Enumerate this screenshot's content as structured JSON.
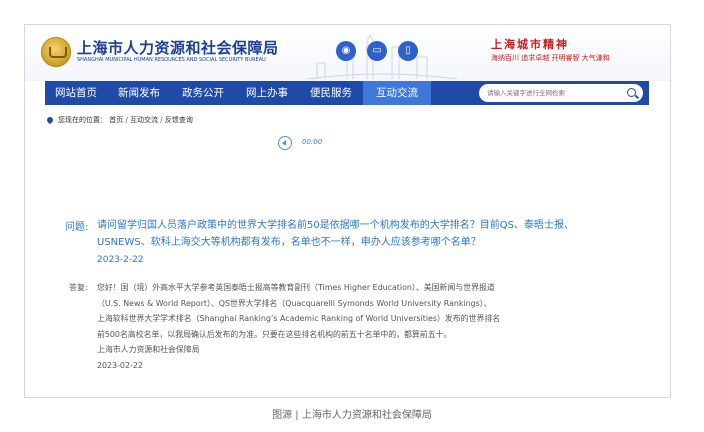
{
  "header": {
    "org_name": "上海市人力资源和社会保障局",
    "org_name_en": "SHANGHAI MUNICIPAL HUMAN RESOURCES AND SOCIAL SECURITY BUREAU",
    "social_icons": [
      "weibo-icon",
      "app-icon",
      "mobile-icon"
    ],
    "spirit_title": "上海城市精神",
    "spirit_sub": "海纳百川  追求卓越  开明睿智  大气谦和"
  },
  "nav": {
    "items": [
      "网站首页",
      "新闻发布",
      "政务公开",
      "网上办事",
      "便民服务",
      "互动交流"
    ],
    "active_index": 5,
    "search_placeholder": "请输入关键字进行全网检索"
  },
  "breadcrumb": {
    "label": "您现在的位置：",
    "items": [
      "首页",
      "互动交流",
      "反馈查询"
    ]
  },
  "audio": {
    "time": "00:00"
  },
  "question": {
    "label": "问题:",
    "text": "请问留学归国人员落户政策中的世界大学排名前50是依据哪一个机构发布的大学排名？目前QS、泰晤士报、USNEWS、软科上海交大等机构都有发布，名单也不一样，申办人应该参考哪个名单？",
    "date": "2023-2-22"
  },
  "answer": {
    "label": "答复:",
    "lines": [
      "您好！国（境）外高水平大学参考英国泰晤士报高等教育副刊（Times Higher Education）、美国新闻与世界报道",
      "（U.S. News & World Report）、QS世界大学排名（Quacquarelli Symonds World University Rankings）、",
      "上海软科世界大学学术排名（Shanghai Ranking’s Academic Ranking of World Universities）发布的世界排名",
      "前500名高校名单，以我局确认后发布的为准。只要在这些排名机构的前五十名单中的，都算前五十。",
      "上海市人力资源和社会保障局",
      "2023-02-22"
    ]
  },
  "caption": "图源 | 上海市人力资源和社会保障局",
  "colors": {
    "nav_bg": "#1f4ba6",
    "nav_active": "#3f78d6",
    "link_blue": "#2a78c8",
    "spirit_red": "#c81d1d"
  }
}
